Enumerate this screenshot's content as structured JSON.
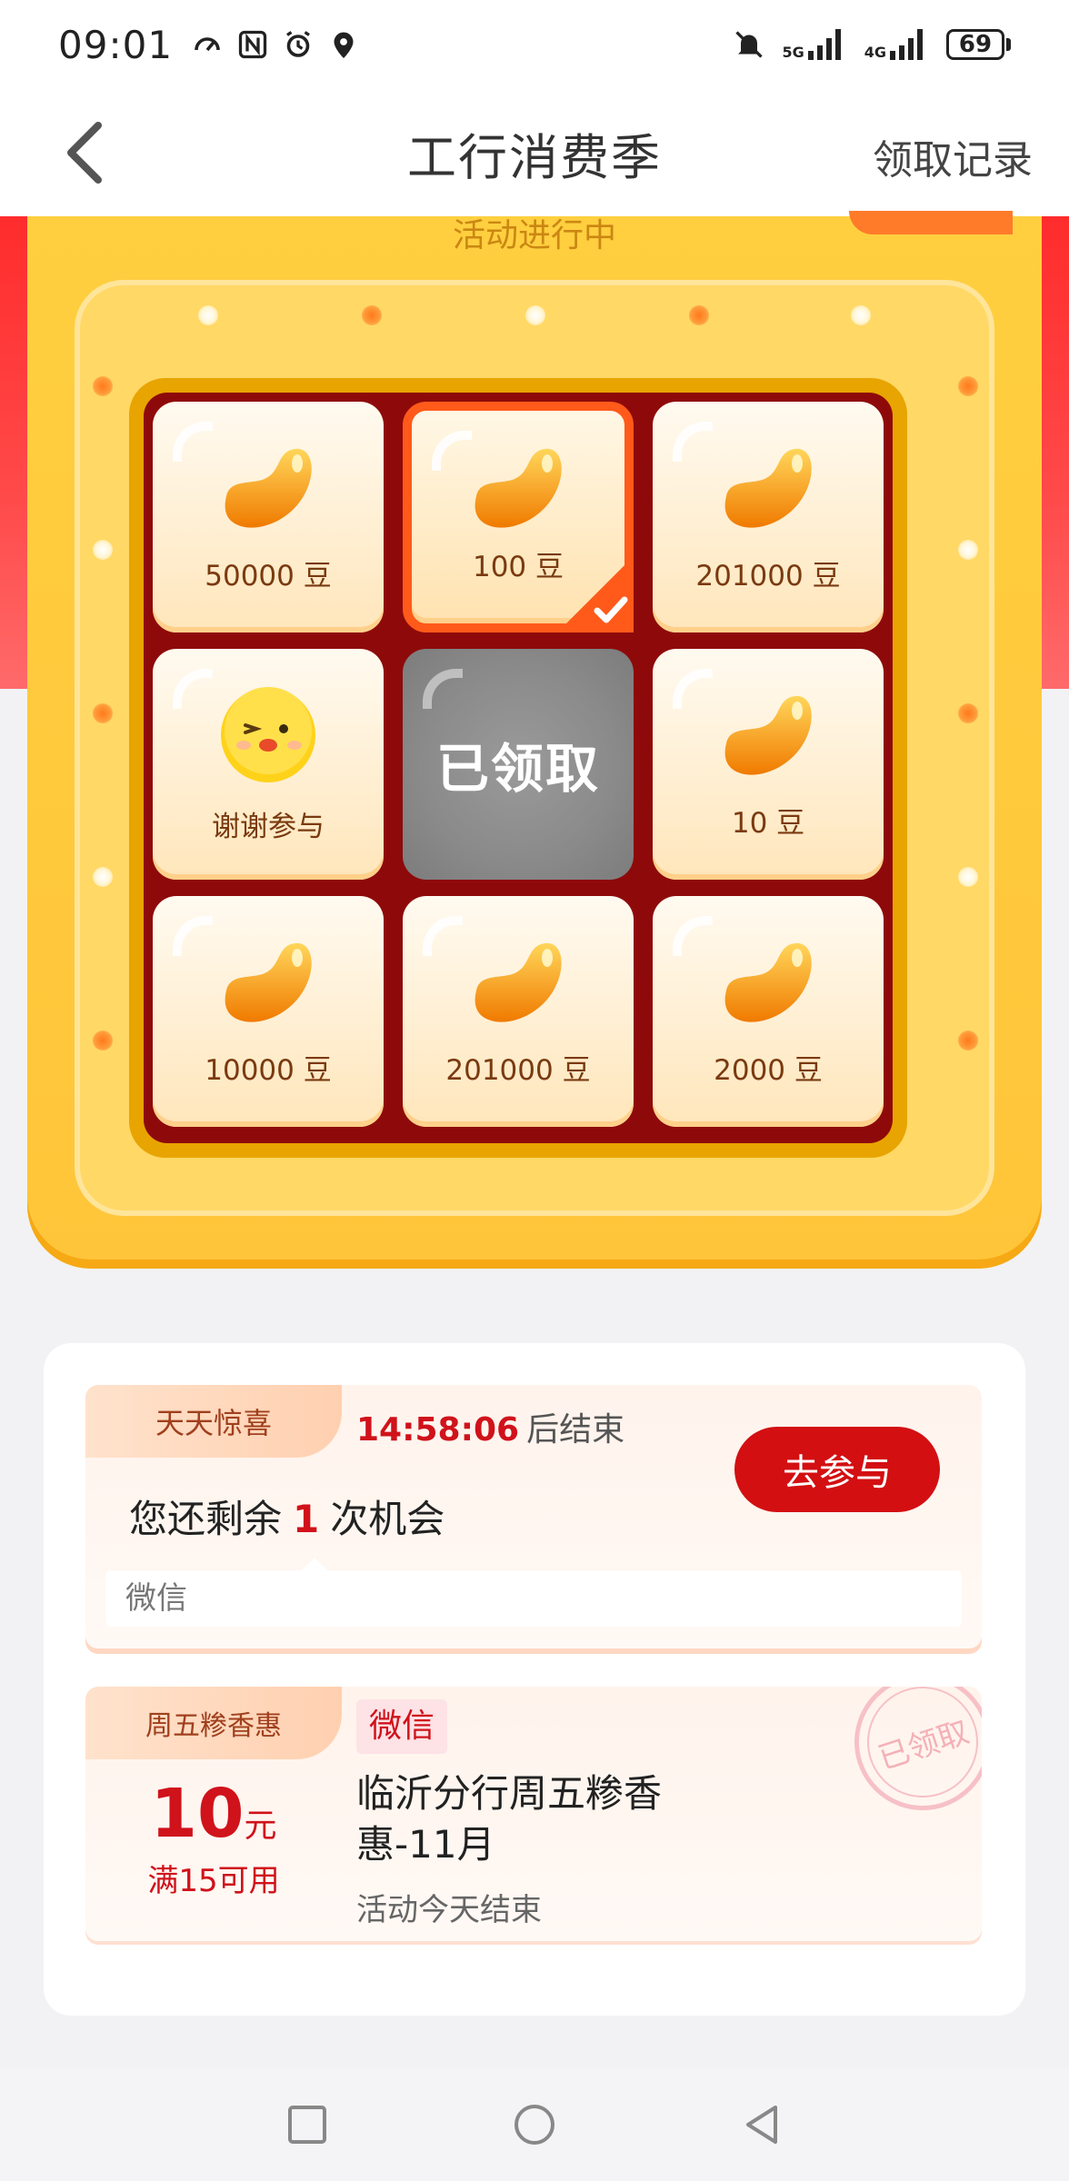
{
  "status_bar": {
    "time": "09:01",
    "battery": "69",
    "network_1": "5G",
    "network_2": "4G"
  },
  "header": {
    "title": "工行消费季",
    "right_link": "领取记录"
  },
  "board": {
    "banner_text": "活动进行中",
    "center_label": "已领取",
    "cells": [
      {
        "label": "50000 豆",
        "icon": "bean-icon"
      },
      {
        "label": "100 豆",
        "icon": "bean-icon",
        "selected": true
      },
      {
        "label": "201000 豆",
        "icon": "bean-icon"
      },
      {
        "label": "谢谢参与",
        "icon": "duck-icon"
      },
      {
        "label": "10 豆",
        "icon": "bean-icon"
      },
      {
        "label": "10000 豆",
        "icon": "bean-icon"
      },
      {
        "label": "201000 豆",
        "icon": "bean-icon"
      },
      {
        "label": "2000 豆",
        "icon": "bean-icon"
      }
    ]
  },
  "promo_daily": {
    "tag": "天天惊喜",
    "countdown": "14:58:06",
    "countdown_suffix": "后结束",
    "chances_prefix": "您还剩余",
    "chances_count": "1",
    "chances_suffix": "次机会",
    "button": "去参与",
    "channel": "微信"
  },
  "promo_friday": {
    "tag": "周五糁香惠",
    "amount": "10",
    "unit": "元",
    "condition": "满15可用",
    "channel": "微信",
    "title": "临沂分行周五糁香惠-11月",
    "subtitle": "活动今天结束",
    "stamp": "已领取"
  },
  "colors": {
    "accent_red": "#d30f12",
    "gold": "#ffc53a",
    "page_bg": "#f2f2f4"
  }
}
